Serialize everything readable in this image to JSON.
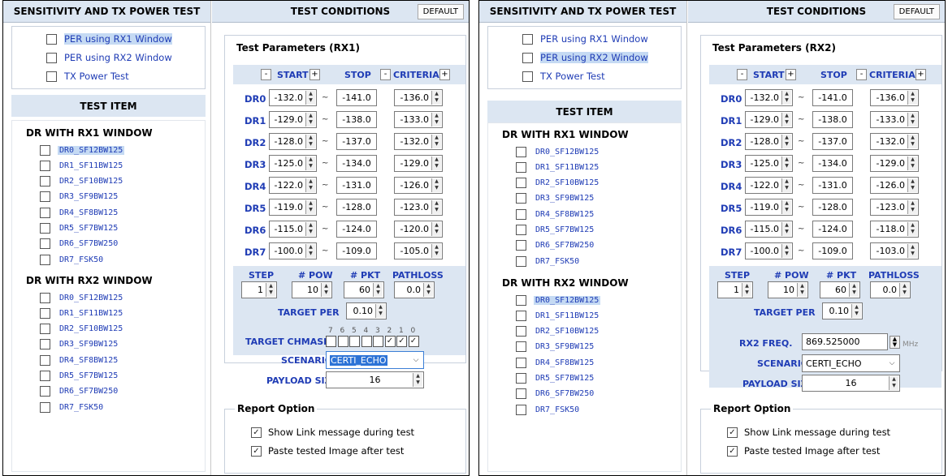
{
  "panels": [
    {
      "left_header": "SENSITIVITY AND TX POWER TEST",
      "right_header": "TEST CONDITIONS",
      "default_button": "DEFAULT",
      "options": [
        {
          "label": "PER using RX1 Window",
          "selected": true
        },
        {
          "label": "PER using RX2 Window",
          "selected": false
        },
        {
          "label": "TX Power Test",
          "selected": false
        }
      ],
      "test_item_header": "TEST ITEM",
      "group1_title": "DR WITH RX1 WINDOW",
      "group1_items": [
        "DR0_SF12BW125",
        "DR1_SF11BW125",
        "DR2_SF10BW125",
        "DR3_SF9BW125",
        "DR4_SF8BW125",
        "DR5_SF7BW125",
        "DR6_SF7BW250",
        "DR7_FSK50"
      ],
      "group1_selected": 0,
      "group2_title": "DR WITH RX2 WINDOW",
      "group2_items": [
        "DR0_SF12BW125",
        "DR1_SF11BW125",
        "DR2_SF10BW125",
        "DR3_SF9BW125",
        "DR4_SF8BW125",
        "DR5_SF7BW125",
        "DR6_SF7BW250",
        "DR7_FSK50"
      ],
      "group2_selected": -1,
      "params_title": "Test Parameters   (RX1)",
      "col_start": "START",
      "col_stop": "STOP",
      "col_criteria": "CRITERIA",
      "minus": "-",
      "plus": "+",
      "rows": [
        {
          "dr": "DR0",
          "start": "-132.0",
          "stop": "-141.0",
          "criteria": "-136.0"
        },
        {
          "dr": "DR1",
          "start": "-129.0",
          "stop": "-138.0",
          "criteria": "-133.0"
        },
        {
          "dr": "DR2",
          "start": "-128.0",
          "stop": "-137.0",
          "criteria": "-132.0"
        },
        {
          "dr": "DR3",
          "start": "-125.0",
          "stop": "-134.0",
          "criteria": "-129.0"
        },
        {
          "dr": "DR4",
          "start": "-122.0",
          "stop": "-131.0",
          "criteria": "-126.0"
        },
        {
          "dr": "DR5",
          "start": "-119.0",
          "stop": "-128.0",
          "criteria": "-123.0"
        },
        {
          "dr": "DR6",
          "start": "-115.0",
          "stop": "-124.0",
          "criteria": "-120.0"
        },
        {
          "dr": "DR7",
          "start": "-100.0",
          "stop": "-109.0",
          "criteria": "-105.0"
        }
      ],
      "step_label": "STEP",
      "pow_label": "# POW",
      "pkt_label": "# PKT",
      "pathloss_label": "PATHLOSS",
      "step": "1",
      "pow": "10",
      "pkt": "60",
      "pathloss": "0.0",
      "target_per_label": "TARGET PER",
      "target_per": "0.10",
      "chmask_label": "TARGET CHMASK",
      "chmask_bits": [
        "7",
        "6",
        "5",
        "4",
        "3",
        "2",
        "1",
        "0"
      ],
      "chmask_checked": [
        false,
        false,
        false,
        false,
        false,
        true,
        true,
        true
      ],
      "scenario_label": "SCENARIO",
      "scenario": "CERTI_ECHO",
      "payload_label": "PAYLOAD SIZE",
      "payload": "16",
      "report_title": "Report Option",
      "report_options": [
        "Show Link message during test",
        "Paste tested Image after test"
      ]
    },
    {
      "left_header": "SENSITIVITY AND TX POWER TEST",
      "right_header": "TEST CONDITIONS",
      "default_button": "DEFAULT",
      "options": [
        {
          "label": "PER using RX1 Window",
          "selected": false
        },
        {
          "label": "PER using RX2 Window",
          "selected": true
        },
        {
          "label": "TX Power Test",
          "selected": false
        }
      ],
      "test_item_header": "TEST ITEM",
      "group1_title": "DR WITH RX1 WINDOW",
      "group1_items": [
        "DR0_SF12BW125",
        "DR1_SF11BW125",
        "DR2_SF10BW125",
        "DR3_SF9BW125",
        "DR4_SF8BW125",
        "DR5_SF7BW125",
        "DR6_SF7BW250",
        "DR7_FSK50"
      ],
      "group1_selected": -1,
      "group2_title": "DR WITH RX2 WINDOW",
      "group2_items": [
        "DR0_SF12BW125",
        "DR1_SF11BW125",
        "DR2_SF10BW125",
        "DR3_SF9BW125",
        "DR4_SF8BW125",
        "DR5_SF7BW125",
        "DR6_SF7BW250",
        "DR7_FSK50"
      ],
      "group2_selected": 0,
      "params_title": "Test Parameters   (RX2)",
      "col_start": "START",
      "col_stop": "STOP",
      "col_criteria": "CRITERIA",
      "minus": "-",
      "plus": "+",
      "rows": [
        {
          "dr": "DR0",
          "start": "-132.0",
          "stop": "-141.0",
          "criteria": "-136.0"
        },
        {
          "dr": "DR1",
          "start": "-129.0",
          "stop": "-138.0",
          "criteria": "-133.0"
        },
        {
          "dr": "DR2",
          "start": "-128.0",
          "stop": "-137.0",
          "criteria": "-132.0"
        },
        {
          "dr": "DR3",
          "start": "-125.0",
          "stop": "-134.0",
          "criteria": "-129.0"
        },
        {
          "dr": "DR4",
          "start": "-122.0",
          "stop": "-131.0",
          "criteria": "-126.0"
        },
        {
          "dr": "DR5",
          "start": "-119.0",
          "stop": "-128.0",
          "criteria": "-123.0"
        },
        {
          "dr": "DR6",
          "start": "-115.0",
          "stop": "-124.0",
          "criteria": "-118.0"
        },
        {
          "dr": "DR7",
          "start": "-100.0",
          "stop": "-109.0",
          "criteria": "-103.0"
        }
      ],
      "step_label": "STEP",
      "pow_label": "# POW",
      "pkt_label": "# PKT",
      "pathloss_label": "PATHLOSS",
      "step": "1",
      "pow": "10",
      "pkt": "60",
      "pathloss": "0.0",
      "target_per_label": "TARGET PER",
      "target_per": "0.10",
      "rx2_freq_label": "RX2 FREQ.",
      "rx2_freq": "869.525000",
      "rx2_freq_unit": "MHz",
      "scenario_label": "SCENARIO",
      "scenario": "CERTI_ECHO",
      "payload_label": "PAYLOAD SIZE",
      "payload": "16",
      "report_title": "Report Option",
      "report_options": [
        "Show Link message during test",
        "Paste tested Image after test"
      ]
    }
  ]
}
